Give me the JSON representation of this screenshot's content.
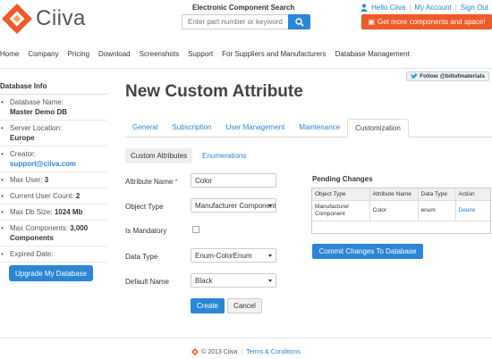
{
  "brand": {
    "name": "Ciiva",
    "accent": "#2b86d6",
    "orange": "#f05a28"
  },
  "header": {
    "search_title": "Electronic Component Search",
    "search_placeholder": "Enter part number or keyword",
    "search_icon": "search-icon",
    "user_greeting": "Hello Ciiva",
    "my_account": "My Account",
    "sign_out": "Sign Out",
    "promo": "Get more components and space!"
  },
  "nav": [
    "Home",
    "Company",
    "Pricing",
    "Download",
    "Screenshots",
    "Support",
    "For Suppliers and Manufacturers",
    "Database Management"
  ],
  "follow": "Follow @billofmaterials",
  "sidebar": {
    "title": "Database Info",
    "db_name_label": "Database Name:",
    "db_name": "Master Demo DB",
    "server_label": "Server Location:",
    "server": "Europe",
    "creator_label": "Creator:",
    "creator": "support@ciiva.com",
    "max_user_label": "Max User:",
    "max_user": "3",
    "user_count_label": "Current User Count:",
    "user_count": "2",
    "db_size_label": "Max Db Size:",
    "db_size": "1024 Mb",
    "max_comp_label": "Max Components:",
    "max_comp": "3,000",
    "max_comp_suffix": "Components",
    "expired_label": "Expired Date:",
    "upgrade": "Upgrade My Database"
  },
  "main": {
    "title": "New Custom Attribute",
    "tabs": [
      "General",
      "Subscription",
      "User Management",
      "Maintenance",
      "Customization"
    ],
    "subtabs": {
      "active": "Custom Attributes",
      "other": "Enumerations"
    },
    "form": {
      "attribute_name_label": "Attribute Name",
      "required_mark": "*",
      "attribute_name_value": "Color",
      "object_type_label": "Object Type",
      "object_type_value": "Manufacturer Component",
      "is_mandatory_label": "Is Mandatory",
      "data_type_label": "Data Type",
      "data_type_value": "Enum-ColorEnum",
      "default_name_label": "Default Name",
      "default_name_value": "Black",
      "create": "Create",
      "cancel": "Cancel"
    },
    "pending": {
      "title": "Pending Changes",
      "columns": [
        "Object Type",
        "Attribute Name",
        "Data Type",
        "Action"
      ],
      "row": {
        "object_type": "Manufacturer Component",
        "attribute_name": "Color",
        "data_type": "enum",
        "action": "Delete"
      },
      "commit": "Commit Changes To Database"
    }
  },
  "footer": {
    "copyright": "© 2013 Ciiva",
    "terms": "Terms & Conditions"
  }
}
